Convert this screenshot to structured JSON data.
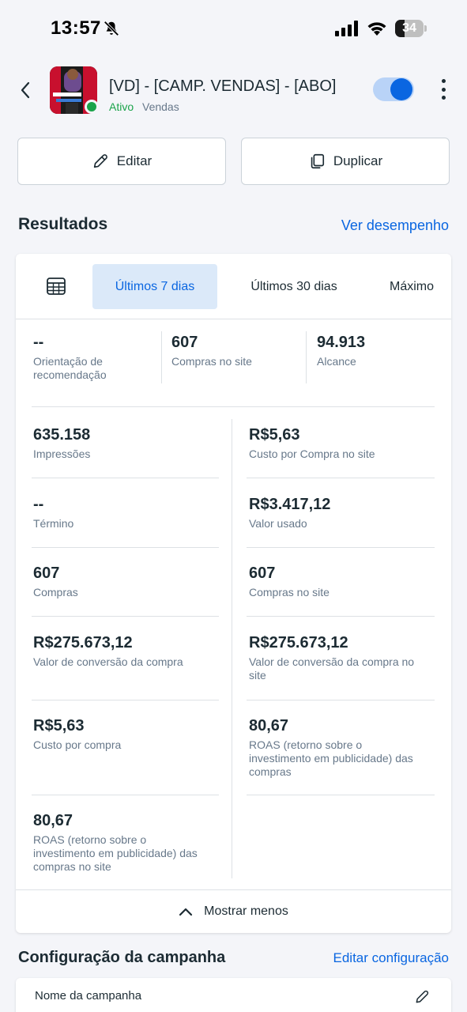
{
  "status_bar": {
    "time": "13:57",
    "battery": "34",
    "battery_level_percent": 34
  },
  "header": {
    "campaign_title": "[VD] - [CAMP. VENDAS] - [ABO]",
    "status": "Ativo",
    "objective": "Vendas",
    "toggle_on": true
  },
  "actions": {
    "edit_label": "Editar",
    "duplicate_label": "Duplicar"
  },
  "results": {
    "title": "Resultados",
    "link": "Ver desempenho",
    "tabs": [
      {
        "label": "Últimos 7 dias",
        "active": true
      },
      {
        "label": "Últimos 30 dias",
        "active": false
      },
      {
        "label": "Máximo",
        "active": false
      }
    ],
    "top_metrics": [
      {
        "value": "--",
        "label": "Orientação de recomendação"
      },
      {
        "value": "607",
        "label": "Compras no site"
      },
      {
        "value": "94.913",
        "label": "Alcance"
      }
    ],
    "left_metrics": [
      {
        "value": "635.158",
        "label": "Impressões"
      },
      {
        "value": "--",
        "label": "Término"
      },
      {
        "value": "607",
        "label": "Compras"
      },
      {
        "value": "R$275.673,12",
        "label": "Valor de conversão da compra"
      },
      {
        "value": "R$5,63",
        "label": "Custo por compra"
      },
      {
        "value": "80,67",
        "label": "ROAS (retorno sobre o investimento em publicidade) das compras no site"
      }
    ],
    "right_metrics": [
      {
        "value": "R$5,63",
        "label": "Custo por Compra no site"
      },
      {
        "value": "R$3.417,12",
        "label": "Valor usado"
      },
      {
        "value": "607",
        "label": "Compras no site"
      },
      {
        "value": "R$275.673,12",
        "label": "Valor de conversão da compra no site"
      },
      {
        "value": "80,67",
        "label": "ROAS (retorno sobre o investimento em publicidade) das compras"
      }
    ],
    "show_less": "Mostrar menos"
  },
  "config": {
    "title": "Configuração da campanha",
    "link": "Editar configuração",
    "field_label": "Nome da campanha"
  },
  "colors": {
    "accent": "#0a66e1",
    "active_green": "#1aa34a",
    "muted_text": "#67788a",
    "background": "#f4f5f9"
  },
  "icons": [
    "bell-muted-icon",
    "signal-icon",
    "wifi-icon",
    "battery-icon",
    "back-arrow-icon",
    "pencil-icon",
    "duplicate-icon",
    "calendar-table-icon",
    "chevron-up-icon",
    "more-vertical-icon"
  ]
}
